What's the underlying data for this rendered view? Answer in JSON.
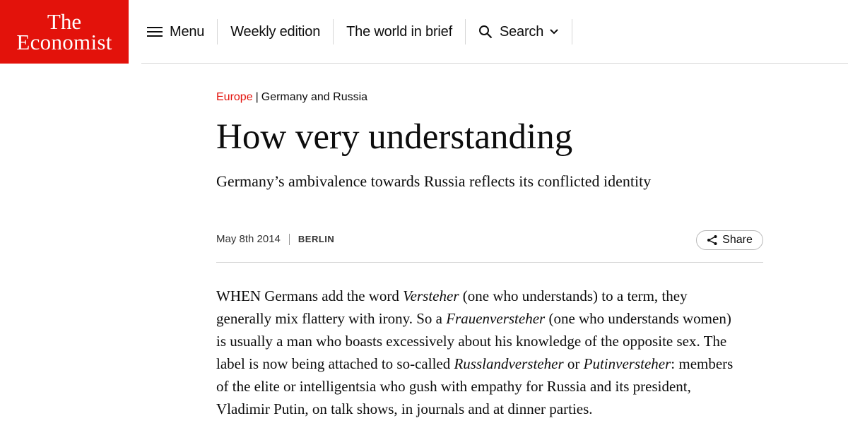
{
  "brand": {
    "line1": "The",
    "line2": "Economist",
    "color": "#e3120b"
  },
  "nav": {
    "menu_label": "Menu",
    "weekly_label": "Weekly edition",
    "brief_label": "The world in brief",
    "search_label": "Search"
  },
  "icons": {
    "menu": "hamburger-icon",
    "search": "search-icon",
    "chevron": "chevron-down-icon",
    "share": "share-icon"
  },
  "article": {
    "section": "Europe",
    "topic": "Germany and Russia",
    "headline": "How very understanding",
    "standfirst": "Germany’s ambivalence towards Russia reflects its conflicted identity",
    "date": "May 8th 2014",
    "dateline": "BERLIN",
    "share_label": "Share",
    "body": [
      {
        "text": "WHEN Germans add the word ",
        "italic": false
      },
      {
        "text": "Versteher",
        "italic": true
      },
      {
        "text": " (one who understands) to a term, they generally mix flattery with irony. So a ",
        "italic": false
      },
      {
        "text": "Frauenversteher",
        "italic": true
      },
      {
        "text": " (one who understands women) is usually a man who boasts excessively about his knowledge of the opposite sex. The label is now being attached to so-called ",
        "italic": false
      },
      {
        "text": "Russlandversteher",
        "italic": true
      },
      {
        "text": " or ",
        "italic": false
      },
      {
        "text": "Putinversteher",
        "italic": true
      },
      {
        "text": ": members of the elite or intelligentsia who gush with empathy for Russia and its president, Vladimir Putin, on talk shows, in journals and at dinner parties.",
        "italic": false
      }
    ]
  }
}
